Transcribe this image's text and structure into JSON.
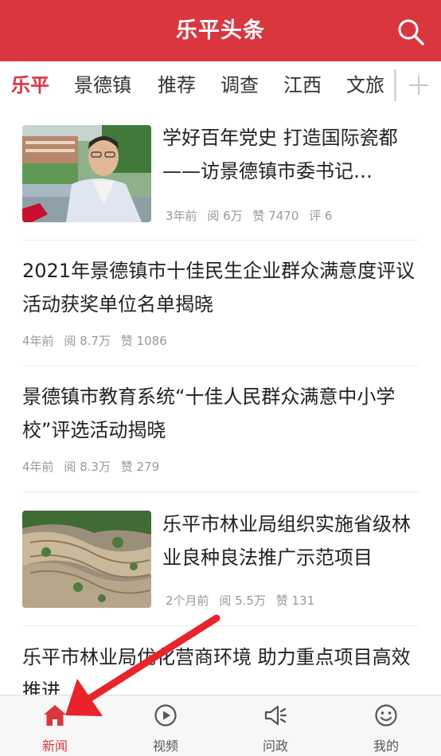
{
  "header": {
    "title": "乐平头条",
    "search_icon": "search-icon"
  },
  "tabs": [
    {
      "label": "乐平",
      "active": true
    },
    {
      "label": "景德镇"
    },
    {
      "label": "推荐"
    },
    {
      "label": "调查"
    },
    {
      "label": "江西"
    },
    {
      "label": "文旅"
    }
  ],
  "articles": [
    {
      "title": "学好百年党史 打造国际瓷都——访景德镇市委书记…",
      "time": "3年前",
      "reads": "阅 6万",
      "likes": "赞 7470",
      "comments": "评 6",
      "has_thumb": true
    },
    {
      "title": "2021年景德镇市十佳民生企业群众满意度评议活动获奖单位名单揭晓",
      "time": "4年前",
      "reads": "阅 8.7万",
      "likes": "赞 1086"
    },
    {
      "title": "景德镇市教育系统“十佳人民群众满意中小学校”评选活动揭晓",
      "time": "4年前",
      "reads": "阅 8.3万",
      "likes": "赞 279"
    },
    {
      "title": "乐平市林业局组织实施省级林业良种良法推广示范项目",
      "time": "2个月前",
      "reads": "阅 5.5万",
      "likes": "赞 131",
      "has_thumb": true
    },
    {
      "title": "乐平市林业局优化营商环境 助力重点项目高效推进"
    }
  ],
  "bottom_nav": [
    {
      "label": "新闻",
      "icon": "home-icon",
      "active": true
    },
    {
      "label": "视频",
      "icon": "play-icon"
    },
    {
      "label": "问政",
      "icon": "megaphone-icon"
    },
    {
      "label": "我的",
      "icon": "smiley-icon"
    }
  ],
  "colors": {
    "brand": "#d9363e",
    "meta_text": "#999999",
    "arrow": "#e8232a"
  }
}
